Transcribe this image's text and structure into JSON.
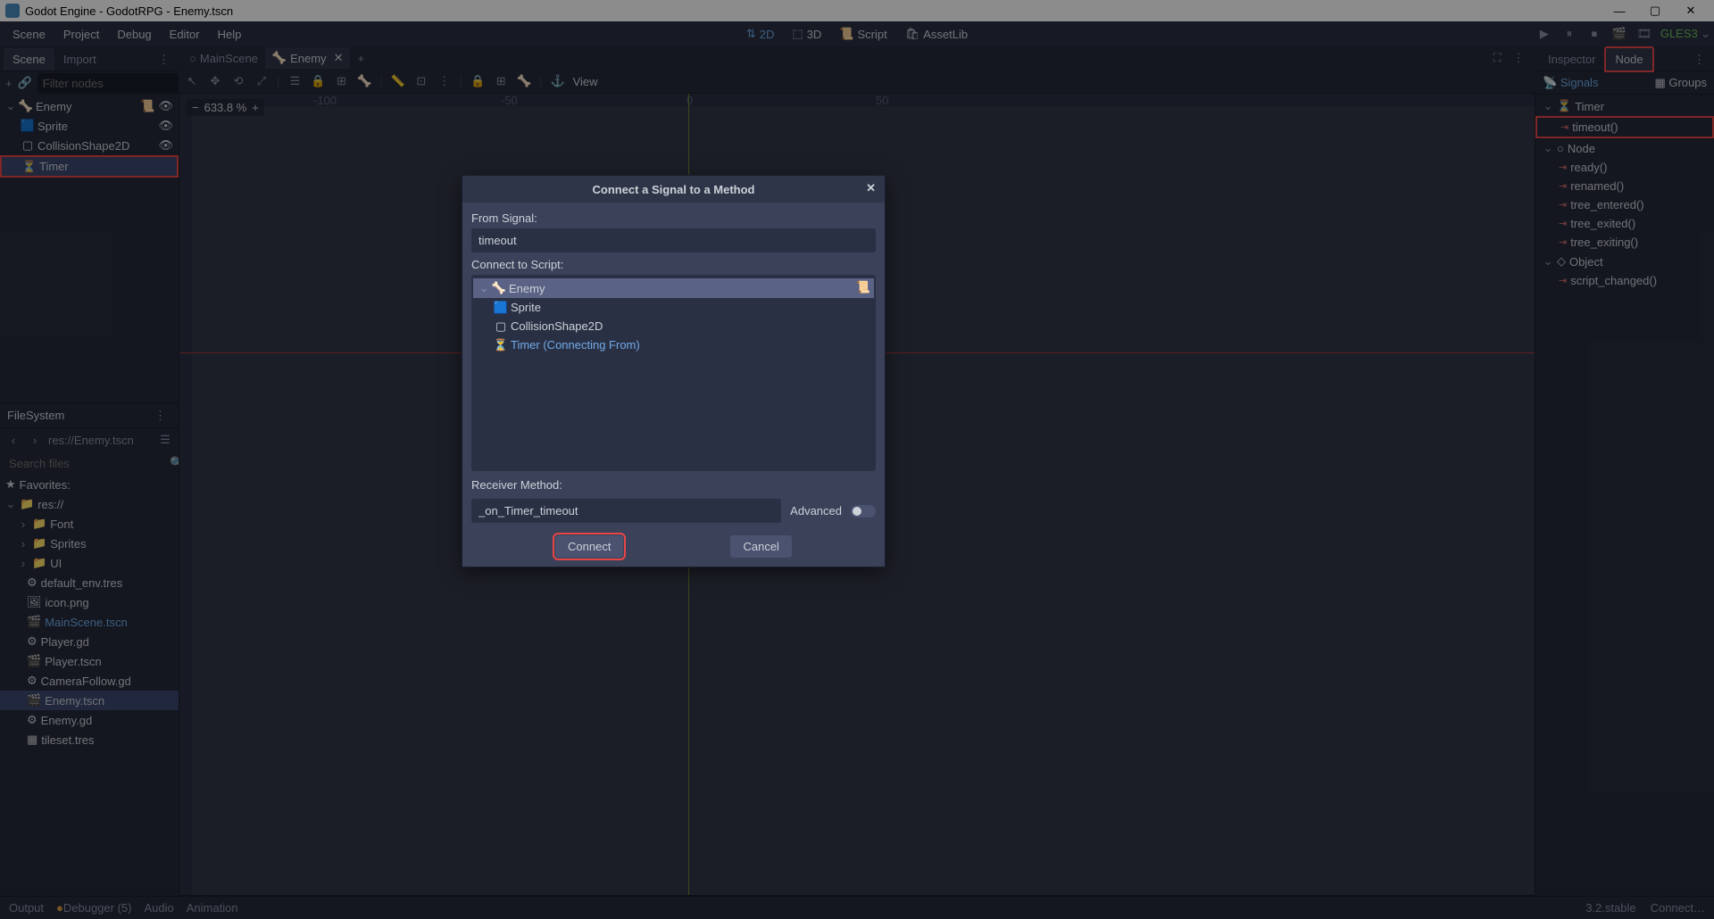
{
  "titlebar": {
    "title": "Godot Engine - GodotRPG - Enemy.tscn",
    "min": "—",
    "max": "▢",
    "close": "✕"
  },
  "menubar": {
    "items": [
      "Scene",
      "Project",
      "Debug",
      "Editor",
      "Help"
    ],
    "workspaces": [
      {
        "label": "2D",
        "active": true
      },
      {
        "label": "3D",
        "active": false
      },
      {
        "label": "Script",
        "active": false
      },
      {
        "label": "AssetLib",
        "active": false
      }
    ],
    "gles": "GLES3"
  },
  "left": {
    "tabs": {
      "scene": "Scene",
      "import": "Import"
    },
    "filter_placeholder": "Filter nodes",
    "tree": [
      {
        "name": "Enemy",
        "icon": "rigid",
        "indent": 0,
        "expand": "⌄",
        "extras": [
          "script",
          "eye"
        ],
        "selected": false
      },
      {
        "name": "Sprite",
        "icon": "sprite",
        "indent": 1,
        "expand": "",
        "extras": [
          "eye"
        ],
        "selected": false
      },
      {
        "name": "CollisionShape2D",
        "icon": "collision",
        "indent": 1,
        "expand": "",
        "extras": [
          "eye"
        ],
        "selected": false
      },
      {
        "name": "Timer",
        "icon": "timer",
        "indent": 1,
        "expand": "",
        "extras": [],
        "selected": true,
        "hl": true
      }
    ]
  },
  "fs": {
    "title": "FileSystem",
    "path": "res://Enemy.tscn",
    "search_placeholder": "Search files",
    "fav": "Favorites:",
    "root": "res://",
    "items": [
      {
        "name": "Font",
        "icon": "folder",
        "indent": 1,
        "chevron": "›"
      },
      {
        "name": "Sprites",
        "icon": "folder",
        "indent": 1,
        "chevron": "›"
      },
      {
        "name": "UI",
        "icon": "folder",
        "indent": 1,
        "chevron": "›"
      },
      {
        "name": "default_env.tres",
        "icon": "env",
        "indent": 1
      },
      {
        "name": "icon.png",
        "icon": "img",
        "indent": 1
      },
      {
        "name": "MainScene.tscn",
        "icon": "scene",
        "indent": 1,
        "link": true
      },
      {
        "name": "Player.gd",
        "icon": "gd",
        "indent": 1
      },
      {
        "name": "Player.tscn",
        "icon": "scene",
        "indent": 1
      },
      {
        "name": "CameraFollow.gd",
        "icon": "gd",
        "indent": 1
      },
      {
        "name": "Enemy.tscn",
        "icon": "scene",
        "indent": 1,
        "selected": true
      },
      {
        "name": "Enemy.gd",
        "icon": "gd",
        "indent": 1
      },
      {
        "name": "tileset.tres",
        "icon": "tiles",
        "indent": 1
      }
    ]
  },
  "center": {
    "tabs": [
      {
        "label": "MainScene",
        "active": false,
        "closable": false
      },
      {
        "label": "Enemy",
        "active": true,
        "closable": true
      }
    ],
    "add": "+",
    "view": "View",
    "zoom": "633.8 %",
    "ruler_labels": [
      "-100",
      "-50",
      "0",
      "50"
    ]
  },
  "right": {
    "tabs": {
      "inspector": "Inspector",
      "node": "Node"
    },
    "subtabs": {
      "signals": "Signals",
      "groups": "Groups"
    },
    "signals": [
      {
        "kind": "header",
        "label": "Timer",
        "icon": "timer",
        "expand": "⌄"
      },
      {
        "kind": "signal",
        "label": "timeout()",
        "hl": true
      },
      {
        "kind": "header",
        "label": "Node",
        "icon": "node",
        "expand": "⌄"
      },
      {
        "kind": "signal",
        "label": "ready()"
      },
      {
        "kind": "signal",
        "label": "renamed()"
      },
      {
        "kind": "signal",
        "label": "tree_entered()"
      },
      {
        "kind": "signal",
        "label": "tree_exited()"
      },
      {
        "kind": "signal",
        "label": "tree_exiting()"
      },
      {
        "kind": "header",
        "label": "Object",
        "icon": "object",
        "expand": "⌄"
      },
      {
        "kind": "signal",
        "label": "script_changed()"
      }
    ]
  },
  "modal": {
    "title": "Connect a Signal to a Method",
    "from_signal_label": "From Signal:",
    "from_signal": "timeout",
    "connect_label": "Connect to Script:",
    "tree": [
      {
        "name": "Enemy",
        "icon": "rigid",
        "indent": 0,
        "expand": "⌄",
        "selected": true,
        "script": true
      },
      {
        "name": "Sprite",
        "icon": "sprite",
        "indent": 1
      },
      {
        "name": "CollisionShape2D",
        "icon": "collision",
        "indent": 1
      },
      {
        "name": "Timer (Connecting From)",
        "icon": "timer",
        "indent": 1,
        "link": true
      }
    ],
    "receiver_label": "Receiver Method:",
    "receiver_value": "_on_Timer_timeout",
    "advanced": "Advanced",
    "connect": "Connect",
    "cancel": "Cancel"
  },
  "bottom": {
    "output": "Output",
    "debugger": "Debugger (5)",
    "audio": "Audio",
    "animation": "Animation",
    "version": "3.2.stable",
    "connect": "Connect…"
  }
}
